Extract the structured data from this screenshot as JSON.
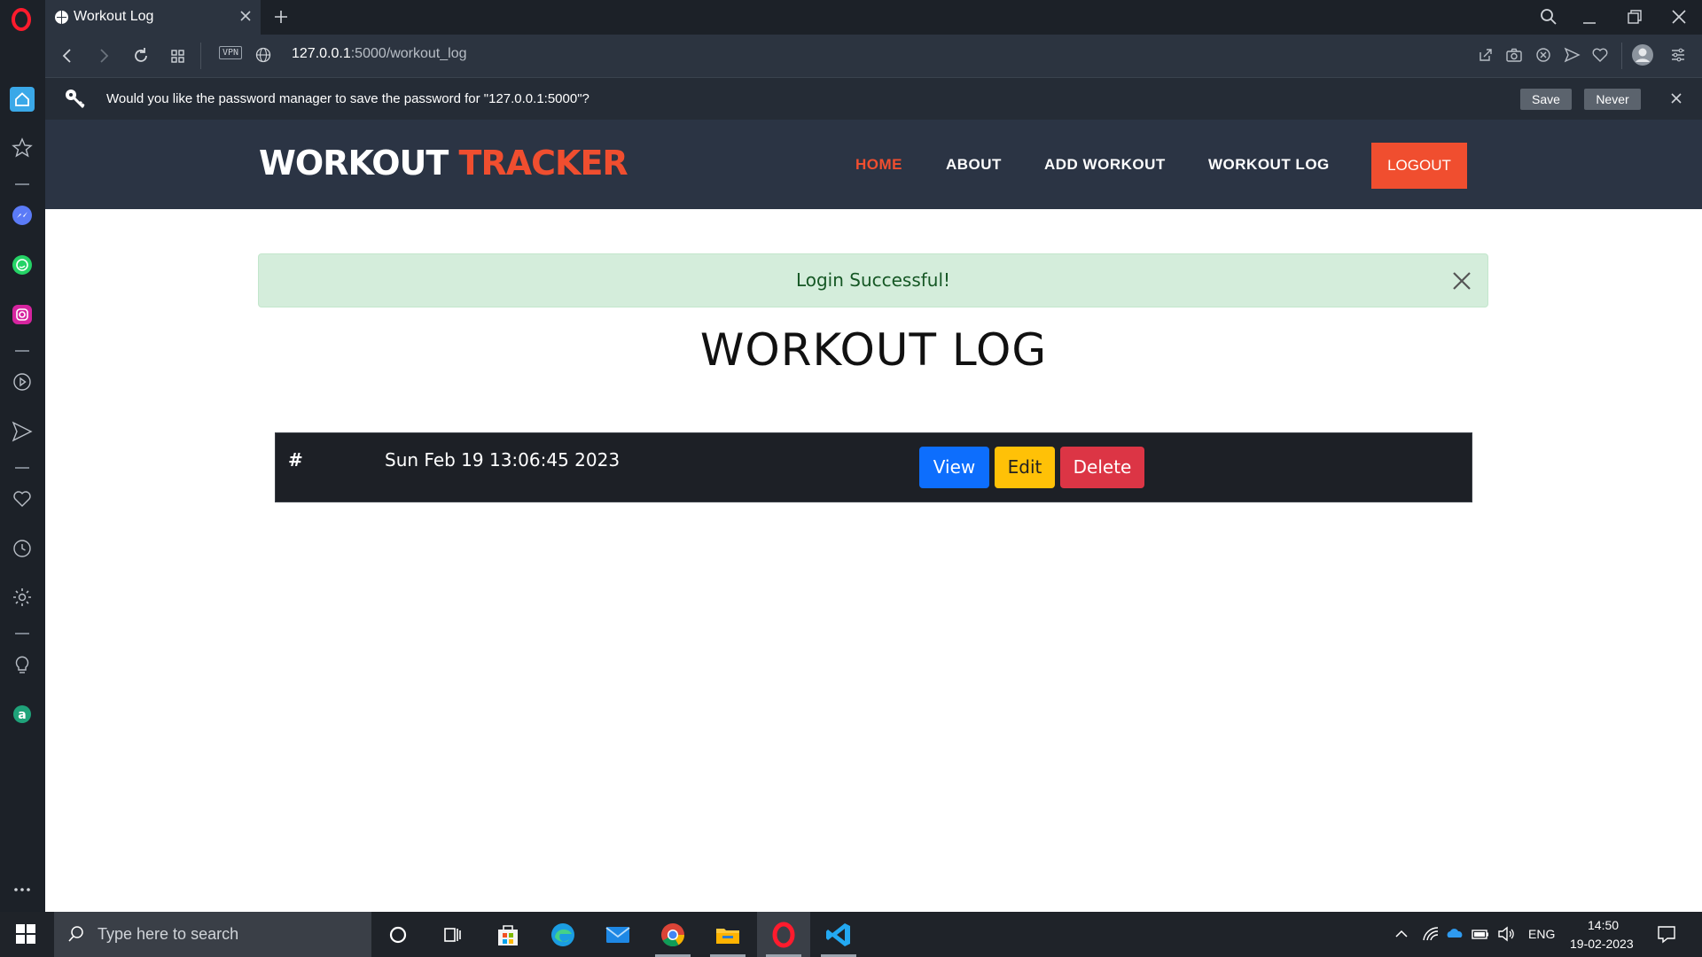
{
  "browser": {
    "tab_title": "Workout Log",
    "url_host": "127.0.0.1",
    "url_path": ":5000/workout_log",
    "vpn_label": "VPN"
  },
  "password_prompt": {
    "message": "Would you like the password manager to save the password for \"127.0.0.1:5000\"?",
    "save_label": "Save",
    "never_label": "Never"
  },
  "site": {
    "logo_word1": "WORKOUT",
    "logo_word2": "TRACKER",
    "nav": {
      "home": "HOME",
      "about": "ABOUT",
      "add_workout": "ADD WORKOUT",
      "workout_log": "WORKOUT LOG",
      "logout": "LOGOUT"
    },
    "alert_text": "Login Successful!",
    "page_title": "WORKOUT LOG",
    "log": {
      "header_hash": "#",
      "entries": [
        {
          "date": "Sun Feb 19 13:06:45 2023",
          "view": "View",
          "edit": "Edit",
          "delete": "Delete"
        }
      ]
    },
    "colors": {
      "header_bg": "#2b3444",
      "accent": "#f04e2f",
      "alert_bg": "#d4eddb",
      "table_bg": "#1d2026"
    }
  },
  "taskbar": {
    "search_placeholder": "Type here to search",
    "language": "ENG",
    "time": "14:50",
    "date": "19-02-2023"
  }
}
